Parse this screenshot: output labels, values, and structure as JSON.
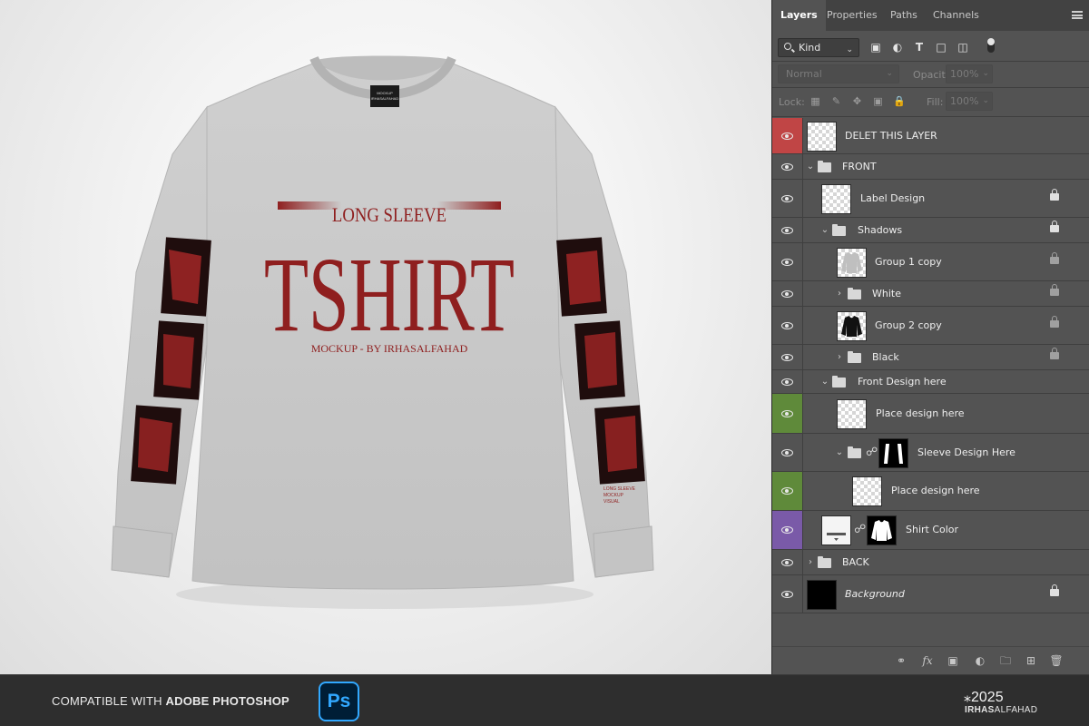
{
  "preview": {
    "neck_label_lines": [
      "MOCKUP",
      "IRHASALFAHAD"
    ],
    "front_print": {
      "top_line": "LONG SLEEVE",
      "main": "TSHIRT",
      "sub_line": "MOCKUP - BY IRHASALFAHAD"
    },
    "sleeve_text_lines": [
      "LONG SLEEVE",
      "MOCKUP",
      "VISUAL"
    ],
    "colors": {
      "shirt": "#c9c9c9",
      "print": "#8f1f1f"
    }
  },
  "footer": {
    "compat_prefix": "COMPATIBLE WITH ",
    "compat_app": "ADOBE PHOTOSHOP",
    "ps_badge": "Ps",
    "year": "⁎2025",
    "brand_bold": "IRHAS",
    "brand_rest": "ALFAHAD"
  },
  "panel": {
    "tabs": [
      "Layers",
      "Properties",
      "Paths",
      "Channels"
    ],
    "active_tab": "Layers",
    "filter_kind": "Kind",
    "blend_mode": "Normal",
    "opacity_label": "Opacity:",
    "opacity_value": "100%",
    "lock_label": "Lock:",
    "fill_label": "Fill:",
    "fill_value": "100%",
    "layers": [
      {
        "name": "DELET THIS LAYER",
        "kind": "layer",
        "thumb": "checker",
        "eye_color": "#c04545"
      },
      {
        "name": "FRONT",
        "kind": "group",
        "expanded": true
      },
      {
        "name": "Label Design",
        "kind": "layer",
        "thumb": "checker",
        "locked": true
      },
      {
        "name": "Shadows",
        "kind": "group",
        "expanded": true,
        "locked": true
      },
      {
        "name": "Group 1 copy",
        "kind": "layer",
        "thumb": "shirt-light",
        "locked": true
      },
      {
        "name": "White",
        "kind": "group",
        "expanded": false,
        "locked": true
      },
      {
        "name": "Group 2 copy",
        "kind": "layer",
        "thumb": "shirt-dark",
        "locked": true
      },
      {
        "name": "Black",
        "kind": "group",
        "expanded": false,
        "locked": true
      },
      {
        "name": "Front Design here",
        "kind": "group",
        "expanded": true
      },
      {
        "name": "Place design here",
        "kind": "layer",
        "thumb": "checker",
        "eye_color": "#5f8a3a"
      },
      {
        "name": "Sleeve Design Here",
        "kind": "group-mask",
        "expanded": true
      },
      {
        "name": "Place design here",
        "kind": "layer",
        "thumb": "checker",
        "eye_color": "#5f8a3a"
      },
      {
        "name": "Shirt Color",
        "kind": "fill-mask",
        "eye_color": "#7a5aa8"
      },
      {
        "name": "BACK",
        "kind": "group",
        "expanded": false
      },
      {
        "name": "Background",
        "kind": "layer",
        "thumb": "black",
        "locked": true
      }
    ]
  }
}
